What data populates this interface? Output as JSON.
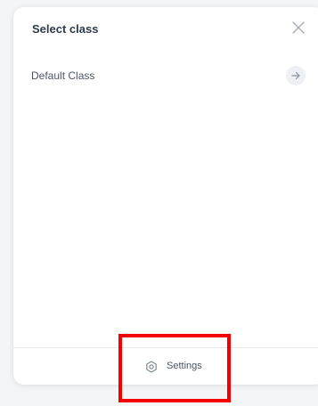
{
  "dialog": {
    "title": "Select class",
    "close_icon": "close-icon"
  },
  "classes": [
    {
      "label": "Default Class",
      "icon": "arrow-right-icon"
    }
  ],
  "footer": {
    "settings_label": "Settings",
    "settings_icon": "gear-icon"
  },
  "colors": {
    "title": "#2f3a4b",
    "text": "#4b5565",
    "highlight": "#f40000",
    "divider": "#e6e8ec"
  }
}
